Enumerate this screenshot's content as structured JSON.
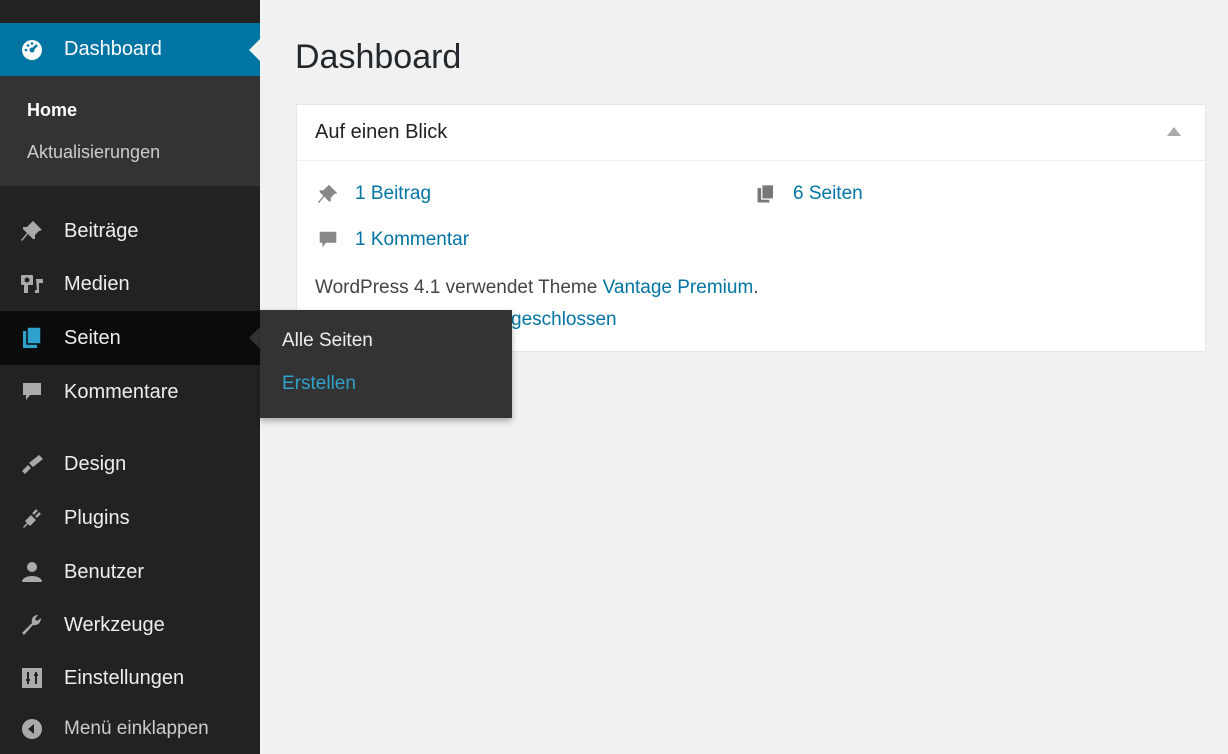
{
  "sidebar": {
    "dashboard_label": "Dashboard",
    "dashboard_submenu": {
      "home": "Home",
      "updates": "Aktualisierungen"
    },
    "items": [
      {
        "label": "Beiträge",
        "icon": "pin-icon"
      },
      {
        "label": "Medien",
        "icon": "media-icon"
      },
      {
        "label": "Seiten",
        "icon": "pages-icon"
      },
      {
        "label": "Kommentare",
        "icon": "comment-icon"
      },
      {
        "label": "Design",
        "icon": "brush-icon"
      },
      {
        "label": "Plugins",
        "icon": "plugin-icon"
      },
      {
        "label": "Benutzer",
        "icon": "user-icon"
      },
      {
        "label": "Werkzeuge",
        "icon": "wrench-icon"
      },
      {
        "label": "Einstellungen",
        "icon": "settings-icon"
      }
    ],
    "collapse_label": "Menü einklappen"
  },
  "flyout": {
    "all_pages": "Alle Seiten",
    "create": "Erstellen"
  },
  "main": {
    "title": "Dashboard",
    "widget": {
      "title": "Auf einen Blick",
      "posts": "1 Beitrag",
      "pages": "6 Seiten",
      "comments": "1 Kommentar",
      "wp_text": "WordPress 4.1 verwendet Theme ",
      "theme_link": "Vantage Premium",
      "period": ".",
      "partial_text": "geschlossen"
    }
  },
  "colors": {
    "sidebar_bg": "#222222",
    "active_blue": "#0074a2",
    "link_blue": "#0074a2",
    "flyout_link": "#2ea2cc"
  }
}
